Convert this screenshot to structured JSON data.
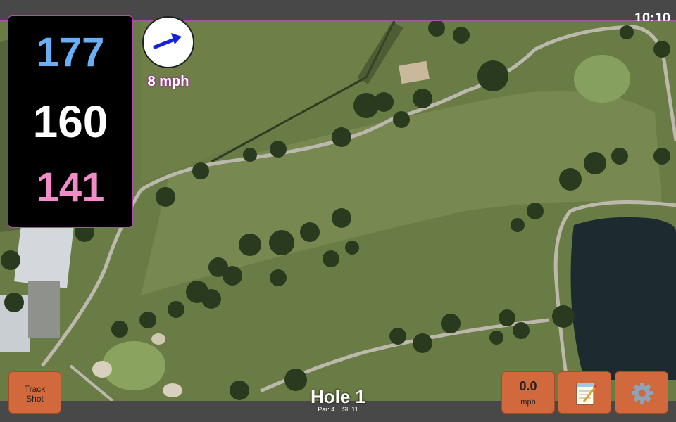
{
  "status": {
    "time": "10:10"
  },
  "distances": {
    "back": "177",
    "middle": "160",
    "front": "141"
  },
  "wind": {
    "speed_label": "8 mph",
    "direction_icon": "arrow-icon"
  },
  "hole": {
    "title": "Hole 1",
    "par_label": "Par: 4",
    "si_label": "SI: 11"
  },
  "buttons": {
    "track_shot_line1": "Track",
    "track_shot_line2": "Shot",
    "wind_speed_value": "0.0",
    "wind_speed_unit": "mph",
    "scorecard_icon": "notepad-icon",
    "settings_icon": "gear-icon"
  },
  "colors": {
    "back": "#6aaef5",
    "middle": "#ffffff",
    "front": "#f08cc8",
    "button": "#d2693c",
    "accent": "#b04fb0"
  }
}
